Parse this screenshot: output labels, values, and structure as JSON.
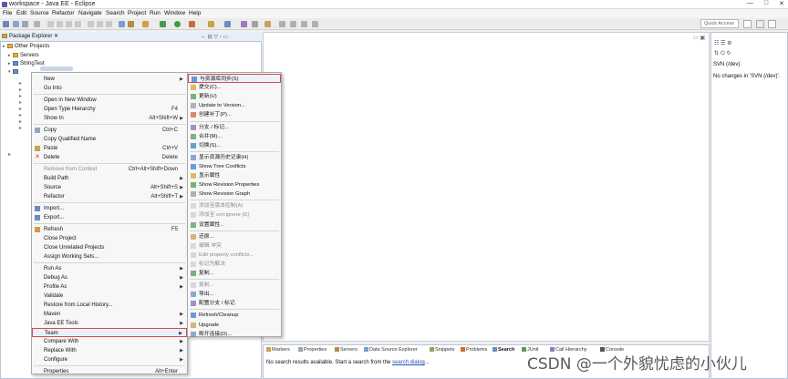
{
  "window": {
    "title": "workspace - Java EE - Eclipse",
    "controls": [
      "—",
      "□",
      "✕"
    ]
  },
  "menubar": [
    "File",
    "Edit",
    "Source",
    "Refactor",
    "Navigate",
    "Search",
    "Project",
    "Run",
    "Window",
    "Help"
  ],
  "quick_access": {
    "placeholder": "Quick Access"
  },
  "package_explorer": {
    "tab_label": "Package Explorer",
    "tree": [
      {
        "label": "Other Projects",
        "arrow": "▸"
      },
      {
        "label": "Servers",
        "arrow": "▸"
      },
      {
        "label": "StringTest",
        "arrow": "▸"
      },
      {
        "label": "",
        "arrow": "▾"
      }
    ]
  },
  "context_menu": {
    "items": [
      {
        "label": "New",
        "shortcut": "",
        "submenu": true
      },
      {
        "label": "Go Into",
        "shortcut": ""
      },
      {
        "sep": true
      },
      {
        "label": "Open in New Window",
        "shortcut": ""
      },
      {
        "label": "Open Type Hierarchy",
        "shortcut": "F4"
      },
      {
        "label": "Show In",
        "shortcut": "Alt+Shift+W",
        "submenu": true
      },
      {
        "sep": true
      },
      {
        "label": "Copy",
        "shortcut": "Ctrl+C",
        "icon": "copy"
      },
      {
        "label": "Copy Qualified Name",
        "shortcut": ""
      },
      {
        "label": "Paste",
        "shortcut": "Ctrl+V",
        "icon": "paste"
      },
      {
        "label": "Delete",
        "shortcut": "Delete",
        "icon": "delete"
      },
      {
        "sep": true
      },
      {
        "label": "Remove from Context",
        "shortcut": "Ctrl+Alt+Shift+Down",
        "disabled": true
      },
      {
        "label": "Build Path",
        "shortcut": "",
        "submenu": true
      },
      {
        "label": "Source",
        "shortcut": "Alt+Shift+S",
        "submenu": true
      },
      {
        "label": "Refactor",
        "shortcut": "Alt+Shift+T",
        "submenu": true
      },
      {
        "sep": true
      },
      {
        "label": "Import...",
        "shortcut": "",
        "icon": "import"
      },
      {
        "label": "Export...",
        "shortcut": "",
        "icon": "export"
      },
      {
        "sep": true
      },
      {
        "label": "Refresh",
        "shortcut": "F5",
        "icon": "refresh"
      },
      {
        "label": "Close Project",
        "shortcut": ""
      },
      {
        "label": "Close Unrelated Projects",
        "shortcut": ""
      },
      {
        "label": "Assign Working Sets...",
        "shortcut": ""
      },
      {
        "sep": true
      },
      {
        "label": "Run As",
        "shortcut": "",
        "submenu": true
      },
      {
        "label": "Debug As",
        "shortcut": "",
        "submenu": true
      },
      {
        "label": "Profile As",
        "shortcut": "",
        "submenu": true
      },
      {
        "label": "Validate",
        "shortcut": ""
      },
      {
        "label": "Restore from Local History...",
        "shortcut": ""
      },
      {
        "label": "Maven",
        "shortcut": "",
        "submenu": true
      },
      {
        "label": "Java EE Tools",
        "shortcut": "",
        "submenu": true
      },
      {
        "label": "Team",
        "shortcut": "",
        "submenu": true,
        "highlight": true
      },
      {
        "label": "Compare With",
        "shortcut": "",
        "submenu": true
      },
      {
        "label": "Replace With",
        "shortcut": "",
        "submenu": true
      },
      {
        "label": "Configure",
        "shortcut": "",
        "submenu": true
      },
      {
        "sep": true
      },
      {
        "label": "Properties",
        "shortcut": "Alt+Enter"
      }
    ]
  },
  "team_submenu": {
    "items": [
      {
        "label": "与资源库同步(S)",
        "highlight": true
      },
      {
        "label": "提交(C)..."
      },
      {
        "label": "更新(U)"
      },
      {
        "label": "Update to Version..."
      },
      {
        "label": "创建补丁(P)..."
      },
      {
        "sep": true
      },
      {
        "label": "分支 / 标记..."
      },
      {
        "label": "合并(M)..."
      },
      {
        "label": "切换(S)..."
      },
      {
        "sep": true
      },
      {
        "label": "显示资源历史记录(H)"
      },
      {
        "label": "Show Tree Conflicts"
      },
      {
        "label": "显示属性"
      },
      {
        "label": "Show Revision Properties"
      },
      {
        "label": "Show Revision Graph"
      },
      {
        "sep": true
      },
      {
        "label": "添加至版本控制(A)",
        "disabled": true
      },
      {
        "label": "添加至 svn:ignore (D)",
        "disabled": true
      },
      {
        "label": "设置属性..."
      },
      {
        "sep": true
      },
      {
        "label": "还原..."
      },
      {
        "label": "编辑 冲突",
        "disabled": true
      },
      {
        "label": "Edit property conflicts...",
        "disabled": true
      },
      {
        "label": "标记为解决",
        "disabled": true
      },
      {
        "label": "复制..."
      },
      {
        "sep": true
      },
      {
        "label": "复制...",
        "disabled": true
      },
      {
        "label": "导出..."
      },
      {
        "label": "配置分支 / 标记"
      },
      {
        "sep": true
      },
      {
        "label": "Refresh/Cleanup"
      },
      {
        "label": "Upgrade"
      },
      {
        "label": "断开连接(D)..."
      }
    ]
  },
  "svn_panel": {
    "title": "SVN (/dev)",
    "message": "No changes in 'SVN (/dev)'."
  },
  "bottom_panel": {
    "tabs": [
      "Markers",
      "Properties",
      "Servers",
      "Data Source Explorer",
      "Snippets",
      "Problems",
      "Search",
      "JUnit",
      "Call Hierarchy",
      "Console"
    ],
    "active_tab": "Search",
    "message_prefix": "No search results available. Start a search from the ",
    "message_link": "search dialog",
    "message_suffix": "..."
  },
  "watermark": "CSDN @一个外貌忧虑的小伙儿",
  "colors": {
    "highlight_border": "#d94a4a",
    "link": "#2a50b8"
  }
}
